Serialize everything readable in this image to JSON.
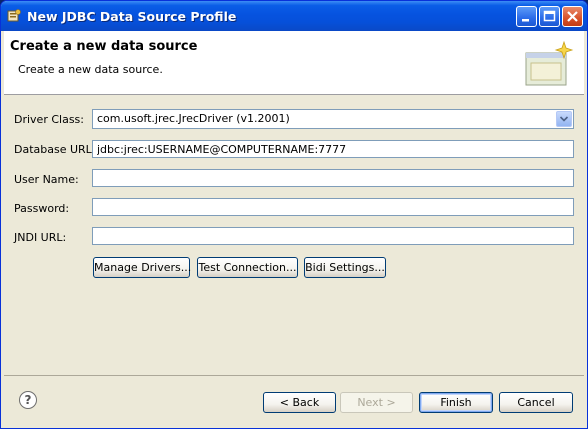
{
  "window": {
    "title": "New JDBC Data Source Profile"
  },
  "header": {
    "title": "Create a new data source",
    "subtitle": "Create a new data source."
  },
  "form": {
    "driver_class": {
      "label": "Driver Class:",
      "value": "com.usoft.jrec.JrecDriver (v1.2001)"
    },
    "database_url": {
      "label": "Database URL:",
      "value": "jdbc:jrec:USERNAME@COMPUTERNAME:7777"
    },
    "user_name": {
      "label": "User Name:",
      "value": ""
    },
    "password": {
      "label": "Password:",
      "value": ""
    },
    "jndi_url": {
      "label": "JNDI URL:",
      "value": ""
    }
  },
  "actions": {
    "manage_drivers": "Manage Drivers...",
    "test_connection": "Test Connection...",
    "bidi_settings": "Bidi Settings..."
  },
  "footer": {
    "back": "< Back",
    "next": "Next >",
    "finish": "Finish",
    "cancel": "Cancel"
  },
  "icons": {
    "app": "database-profile-icon",
    "header": "wizard-banner-icon",
    "help": "help-icon",
    "dropdown": "chevron-down-icon"
  }
}
